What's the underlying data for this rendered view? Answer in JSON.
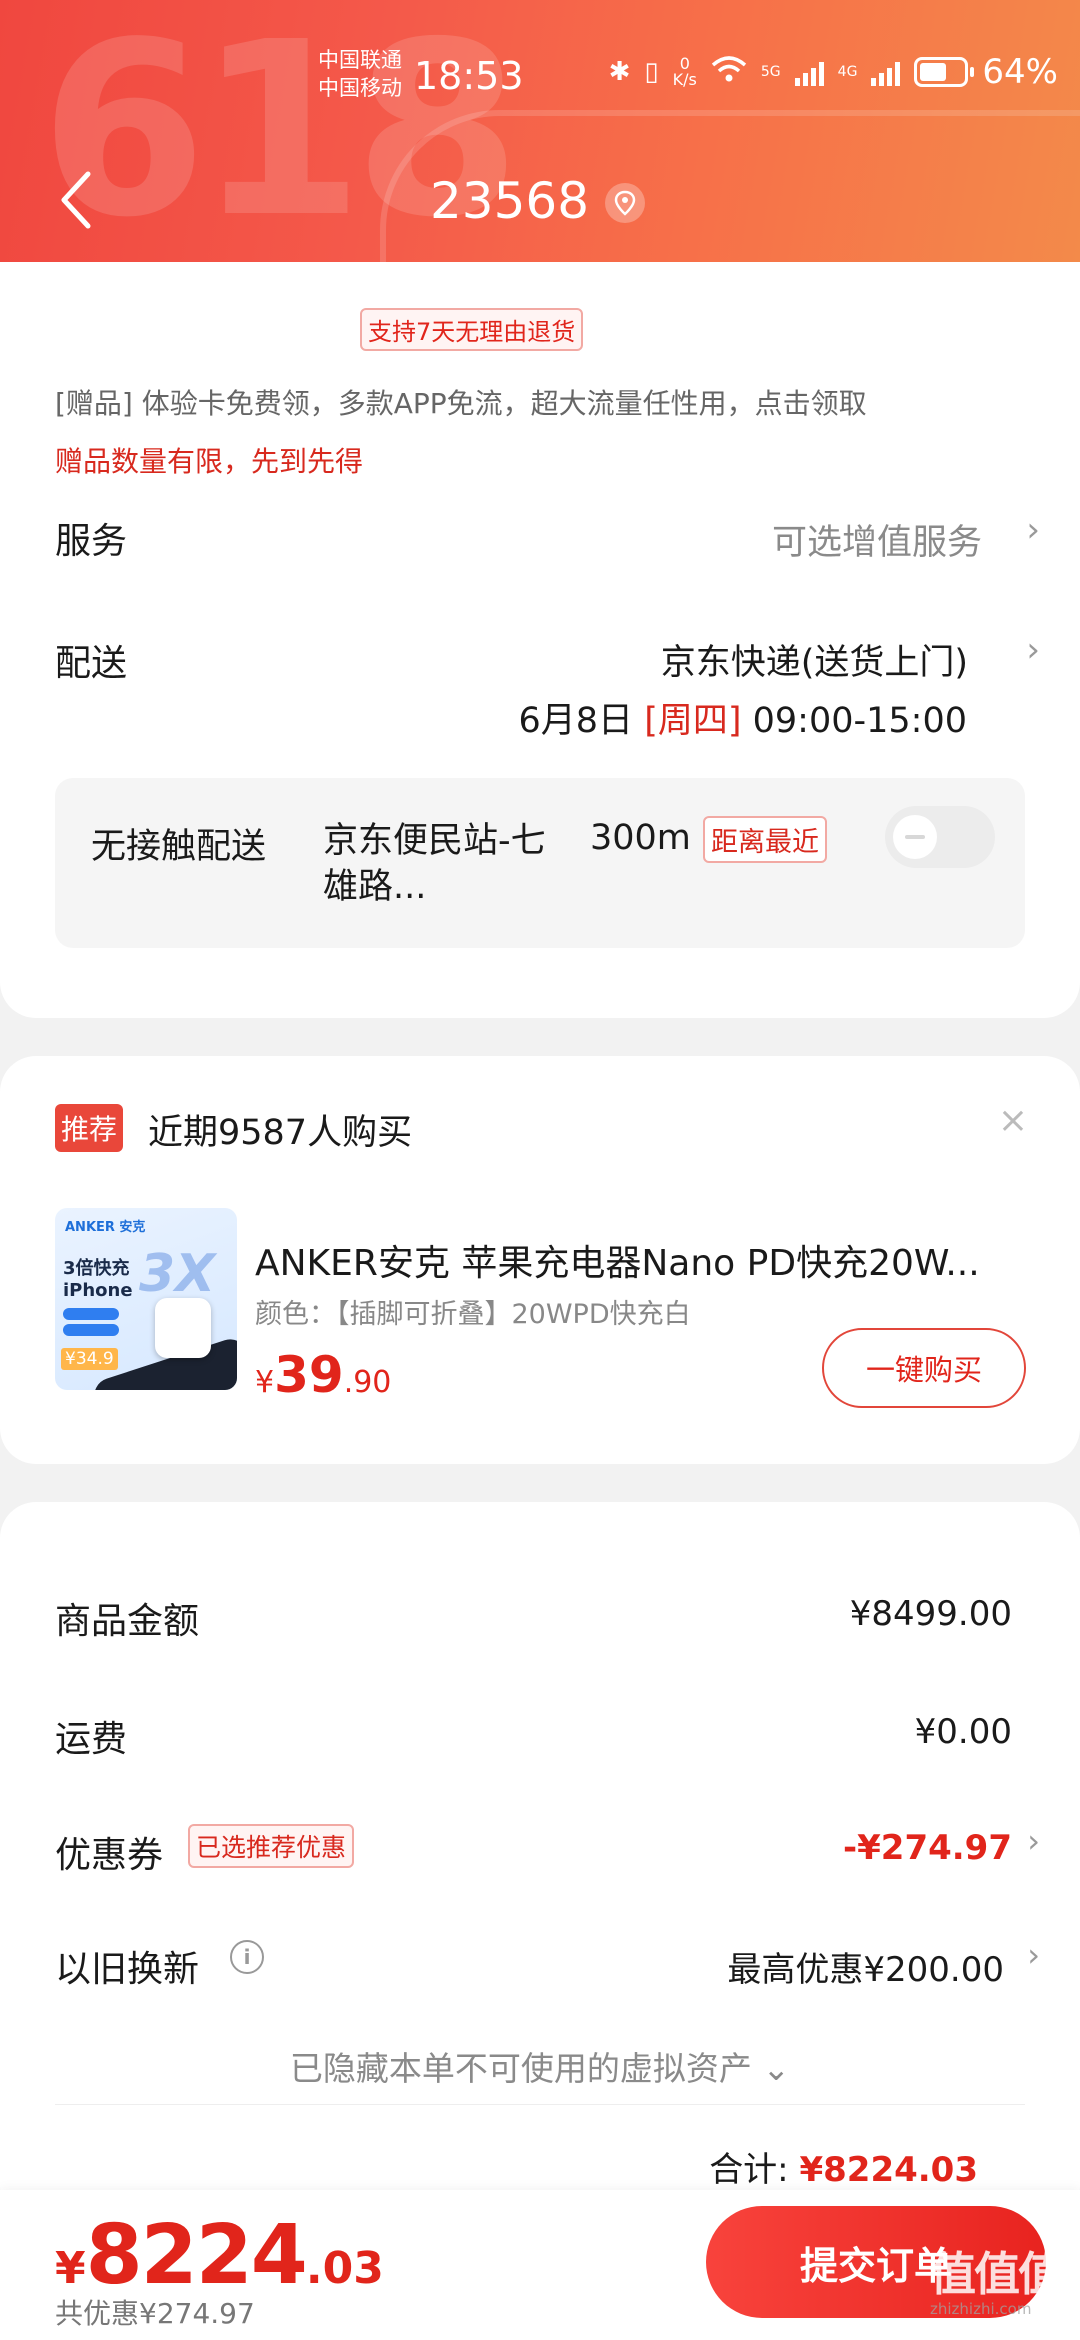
{
  "status_bar": {
    "carrier1": "中国联通",
    "carrier2": "中国移动",
    "time": "18:53",
    "net_speed_value": "0",
    "net_speed_unit": "K/s",
    "signal1": "5G",
    "signal2": "4G",
    "battery": "64%"
  },
  "header": {
    "bg_text": "618",
    "title": "23568"
  },
  "delivery_card": {
    "return_policy": "支持7天无理由退货",
    "gift_line": "[赠品]  体验卡免费领，多款APP免流，超大流量任性用，点击领取",
    "gift_limit": "赠品数量有限，先到先得",
    "service_label": "服务",
    "service_value": "可选增值服务",
    "delivery_label": "配送",
    "delivery_value": "京东快递(送货上门)",
    "delivery_date": "6月8日",
    "delivery_weekday": "[周四]",
    "delivery_window": "09:00-15:00",
    "contactless_label": "无接触配送",
    "station": "京东便民站-七雄路...",
    "distance": "300m",
    "nearest_tag": "距离最近"
  },
  "recommend_card": {
    "tag": "推荐",
    "title": "近期9587人购买",
    "close": "×",
    "product": {
      "image_brand": "ANKER 安克",
      "image_headline": "3倍快充",
      "image_device": "iPhone",
      "image_badge": "3X",
      "image_price": "¥34.9",
      "name": "ANKER安克 苹果充电器Nano PD快充20W...",
      "spec": "颜色：【插脚可折叠】20WPD快充白",
      "price_currency": "¥",
      "price_int": "39",
      "price_dec": ".90",
      "buy_label": "一键购买"
    }
  },
  "summary_card": {
    "goods_label": "商品金额",
    "goods_value": "¥8499.00",
    "shipping_label": "运费",
    "shipping_value": "¥0.00",
    "coupon_label": "优惠券",
    "coupon_tag": "已选推荐优惠",
    "coupon_value": "-¥274.97",
    "tradein_label": "以旧换新",
    "tradein_value": "最高优惠¥200.00",
    "hidden_assets": "已隐藏本单不可使用的虚拟资产",
    "total_label": "合计:",
    "total_value": "¥8224.03"
  },
  "bottom_bar": {
    "currency": "¥",
    "price_int": "8224",
    "price_dec": ".03",
    "saved": "共优惠¥274.97",
    "submit_label": "提交订单"
  },
  "watermark": {
    "mark": "值值值",
    "site": "zhizhizhi.com"
  },
  "colors": {
    "accent": "#e1251b",
    "header_start": "#f0473f",
    "header_end": "#f38a4a"
  },
  "icons": [
    "back-arrow-icon",
    "location-pin-icon",
    "chevron-right-icon",
    "info-icon",
    "chevron-down-icon",
    "close-icon",
    "bluetooth-icon",
    "wifi-icon",
    "battery-icon"
  ]
}
